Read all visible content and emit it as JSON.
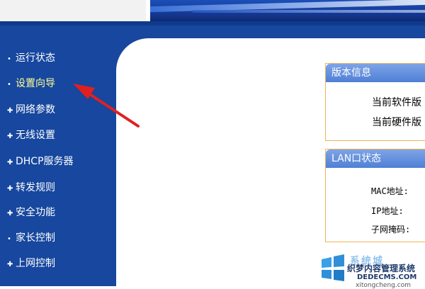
{
  "sidebar": {
    "items": [
      {
        "label": "运行状态"
      },
      {
        "label": "设置向导"
      },
      {
        "label": "网络参数"
      },
      {
        "label": "无线设置"
      },
      {
        "label": "DHCP服务器"
      },
      {
        "label": "转发规则"
      },
      {
        "label": "安全功能"
      },
      {
        "label": "家长控制"
      },
      {
        "label": "上网控制"
      }
    ],
    "active_index": 1
  },
  "version_box": {
    "title": "版本信息",
    "rows": [
      "当前软件版",
      "当前硬件版"
    ]
  },
  "lan_box": {
    "title": "LAN口状态",
    "rows": [
      "MAC地址:",
      "IP地址:",
      "子网掩码:"
    ]
  },
  "annotation": {
    "arrow_color": "#e02020",
    "points_to": "设置向导"
  },
  "watermark": {
    "logo": "windows-logo",
    "text_main": "系统城",
    "text_site": "织梦内容管理系统",
    "text_url": "DEDECMS.COM",
    "text_sub": "xitongcheng.com"
  },
  "colors": {
    "sidebar_bg": "#17479e",
    "box_border": "#f0b45a",
    "box_header": "#4f7fd6"
  }
}
